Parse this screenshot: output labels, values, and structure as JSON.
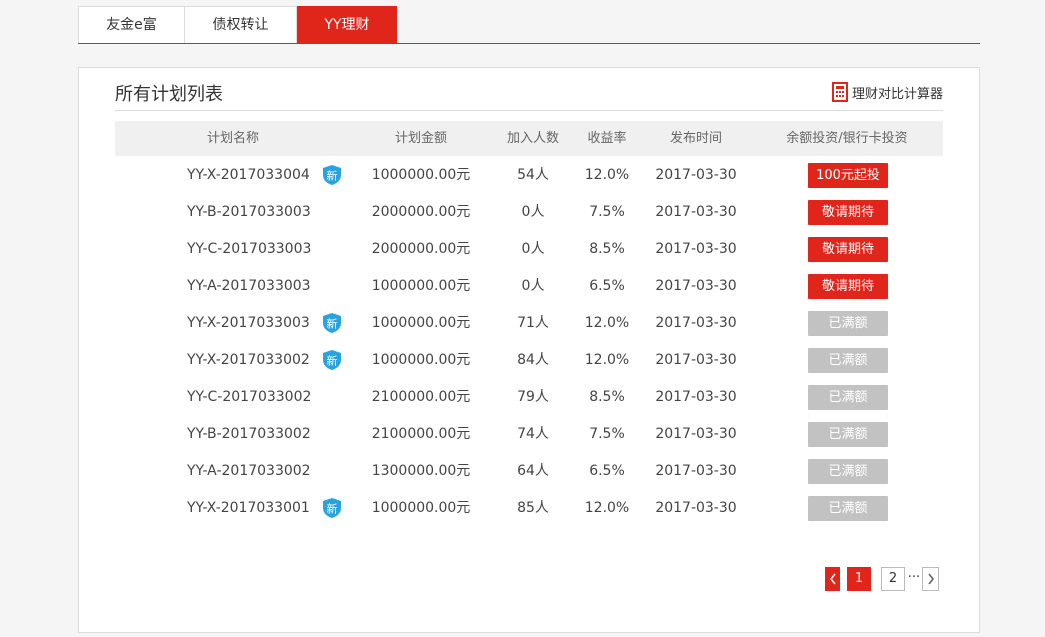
{
  "tabs": [
    {
      "label": "友金e富",
      "active": false
    },
    {
      "label": "债权转让",
      "active": false
    },
    {
      "label": "YY理财",
      "active": true
    }
  ],
  "panel": {
    "title": "所有计划列表",
    "calculator_label": "理财对比计算器",
    "calculator_icon": "calculator-icon"
  },
  "table": {
    "headers": [
      "计划名称",
      "计划金额",
      "加入人数",
      "收益率",
      "发布时间",
      "余额投资/银行卡投资"
    ],
    "new_badge_label": "新",
    "rows": [
      {
        "name": "YY-X-2017033004",
        "is_new": true,
        "amount": "1000000.00元",
        "members": "54人",
        "rate": "12.0%",
        "date": "2017-03-30",
        "action": "100元起投",
        "action_style": "red"
      },
      {
        "name": "YY-B-2017033003",
        "is_new": false,
        "amount": "2000000.00元",
        "members": "0人",
        "rate": "7.5%",
        "date": "2017-03-30",
        "action": "敬请期待",
        "action_style": "red"
      },
      {
        "name": "YY-C-2017033003",
        "is_new": false,
        "amount": "2000000.00元",
        "members": "0人",
        "rate": "8.5%",
        "date": "2017-03-30",
        "action": "敬请期待",
        "action_style": "red"
      },
      {
        "name": "YY-A-2017033003",
        "is_new": false,
        "amount": "1000000.00元",
        "members": "0人",
        "rate": "6.5%",
        "date": "2017-03-30",
        "action": "敬请期待",
        "action_style": "red"
      },
      {
        "name": "YY-X-2017033003",
        "is_new": true,
        "amount": "1000000.00元",
        "members": "71人",
        "rate": "12.0%",
        "date": "2017-03-30",
        "action": "已满额",
        "action_style": "gray"
      },
      {
        "name": "YY-X-2017033002",
        "is_new": true,
        "amount": "1000000.00元",
        "members": "84人",
        "rate": "12.0%",
        "date": "2017-03-30",
        "action": "已满额",
        "action_style": "gray"
      },
      {
        "name": "YY-C-2017033002",
        "is_new": false,
        "amount": "2100000.00元",
        "members": "79人",
        "rate": "8.5%",
        "date": "2017-03-30",
        "action": "已满额",
        "action_style": "gray"
      },
      {
        "name": "YY-B-2017033002",
        "is_new": false,
        "amount": "2100000.00元",
        "members": "74人",
        "rate": "7.5%",
        "date": "2017-03-30",
        "action": "已满额",
        "action_style": "gray"
      },
      {
        "name": "YY-A-2017033002",
        "is_new": false,
        "amount": "1300000.00元",
        "members": "64人",
        "rate": "6.5%",
        "date": "2017-03-30",
        "action": "已满额",
        "action_style": "gray"
      },
      {
        "name": "YY-X-2017033001",
        "is_new": true,
        "amount": "1000000.00元",
        "members": "85人",
        "rate": "12.0%",
        "date": "2017-03-30",
        "action": "已满额",
        "action_style": "gray"
      }
    ]
  },
  "pagination": {
    "prev_icon": "chevron-left-icon",
    "pages": [
      "1",
      "2"
    ],
    "current": "1",
    "ellipsis": "···",
    "next_icon": "chevron-right-icon"
  },
  "colors": {
    "accent": "#e0251b",
    "disabled": "#c2c2c2",
    "badge": "#29a3e0"
  }
}
